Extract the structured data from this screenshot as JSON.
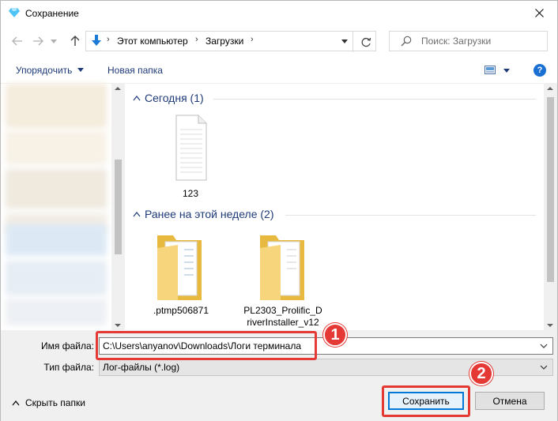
{
  "window": {
    "title": "Сохранение",
    "title_icon": "diamond-app-icon"
  },
  "address": {
    "crumbs": [
      "Этот компьютер",
      "Загрузки"
    ],
    "search_placeholder": "Поиск: Загрузки"
  },
  "toolbar": {
    "organize_label": "Упорядочить",
    "new_folder_label": "Новая папка",
    "help_label": "?"
  },
  "groups": [
    {
      "title": "Сегодня (1)",
      "items": [
        {
          "name": "123",
          "icon": "document-icon"
        }
      ]
    },
    {
      "title": "Ранее на этой неделе (2)",
      "items": [
        {
          "name": ".ptmp506871",
          "icon": "folder-icon"
        },
        {
          "name": "PL2303_Prolific_DriverInstaller_v12",
          "name_line1": "PL2303_Prolific_D",
          "name_line2": "riverInstaller_v12",
          "icon": "folder-icon"
        }
      ]
    }
  ],
  "form": {
    "filename_label": "Имя файла:",
    "filename_value": "C:\\Users\\anyanov\\Downloads\\Логи терминала",
    "filetype_label": "Тип файла:",
    "filetype_value": "Лог-файлы (*.log)",
    "hide_folders_label": "Скрыть папки",
    "save_label": "Сохранить",
    "cancel_label": "Отмена"
  },
  "annotations": {
    "badge1": "1",
    "badge2": "2",
    "color": "#e53935"
  },
  "colors": {
    "accent": "#0078d7",
    "link_blue": "#1e3a78",
    "folder_yellow": "#f5d477"
  }
}
